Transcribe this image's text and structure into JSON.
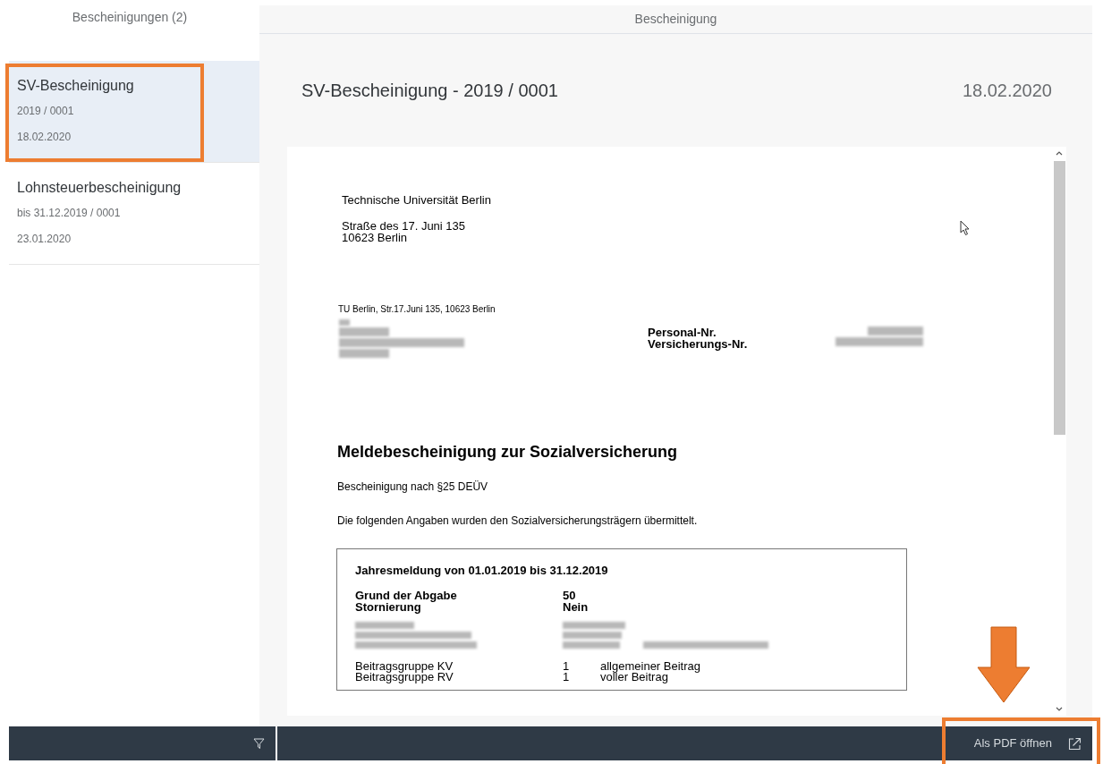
{
  "sidebar": {
    "title": "Bescheinigungen (2)",
    "items": [
      {
        "title": "SV-Bescheinigung",
        "subtitle": "2019 / 0001",
        "date": "18.02.2020",
        "selected": true
      },
      {
        "title": "Lohnsteuerbescheinigung",
        "subtitle": "bis 31.12.2019 / 0001",
        "date": "23.01.2020",
        "selected": false
      }
    ]
  },
  "detail": {
    "header": "Bescheinigung",
    "title": "SV-Bescheinigung - 2019 / 0001",
    "date": "18.02.2020",
    "document": {
      "sender_name": "Technische Universität Berlin",
      "sender_street": "Straße des 17. Juni 135",
      "sender_city": "10623 Berlin",
      "return_address": "TU Berlin, Str.17.Juni 135, 10623 Berlin",
      "id_labels": [
        "Personal-Nr.",
        "Versicherungs-Nr."
      ],
      "heading": "Meldebescheinigung zur Sozialversicherung",
      "paragraphs": [
        "Bescheinigung nach §25 DEÜV",
        "Die folgenden Angaben wurden den Sozialversicherungsträgern übermittelt."
      ],
      "box": {
        "title": "Jahresmeldung von 01.01.2019 bis 31.12.2019",
        "bold_rows": [
          {
            "label": "Grund der Abgabe",
            "value": "50"
          },
          {
            "label": "Stornierung",
            "value": "Nein"
          }
        ],
        "rows": [
          {
            "label": "Beitragsgruppe KV",
            "value": "1",
            "description": "allgemeiner Beitrag"
          },
          {
            "label": "Beitragsgruppe RV",
            "value": "1",
            "description": "voller Beitrag"
          }
        ]
      }
    }
  },
  "footer": {
    "action": "Als PDF öffnen"
  }
}
